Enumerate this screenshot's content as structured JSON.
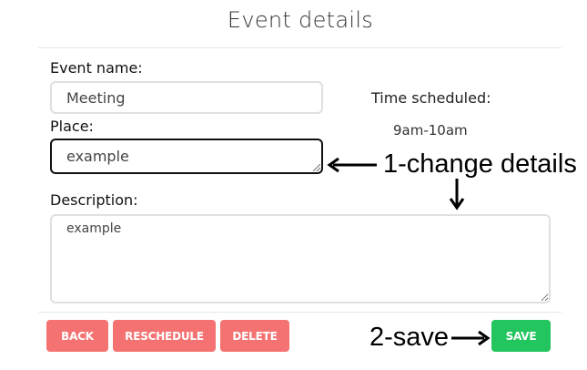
{
  "header": {
    "title": "Event details"
  },
  "form": {
    "event_name": {
      "label": "Event name:",
      "value": "Meeting"
    },
    "place": {
      "label": "Place:",
      "value": "example"
    },
    "description": {
      "label": "Description:",
      "value": "example"
    }
  },
  "schedule": {
    "label": "Time scheduled:",
    "value": "9am-10am"
  },
  "actions": {
    "back": "BACK",
    "reschedule": "RESCHEDULE",
    "delete": "DELETE",
    "save": "SAVE"
  },
  "annotations": {
    "step1": "1-change details",
    "step2": "2-save"
  },
  "colors": {
    "danger": "#f47272",
    "success": "#22c55e"
  }
}
